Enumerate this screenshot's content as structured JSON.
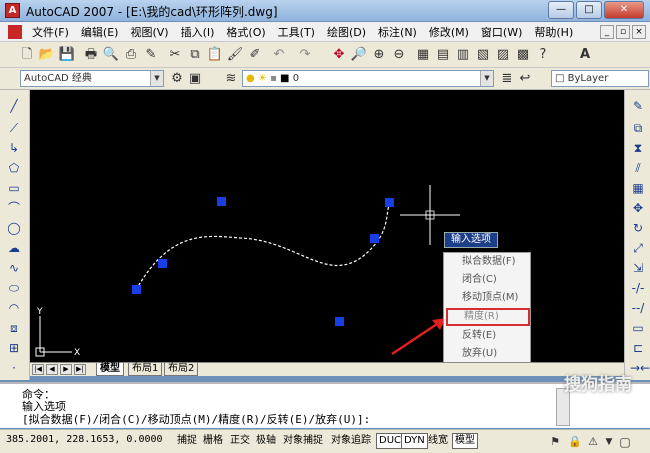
{
  "window": {
    "title": "AutoCAD 2007 - [E:\\我的cad\\环形阵列.dwg]"
  },
  "menu": [
    "文件(F)",
    "编辑(E)",
    "视图(V)",
    "插入(I)",
    "格式(O)",
    "工具(T)",
    "绘图(D)",
    "标注(N)",
    "修改(M)",
    "窗口(W)",
    "帮助(H)"
  ],
  "toolbar2": {
    "workspace": "AutoCAD 经典",
    "layer": "0",
    "linetype": "ByLayer"
  },
  "context_menu": {
    "title": "输入选项",
    "items": [
      "拟合数据(F)",
      "闭合(C)",
      "移动顶点(M)",
      "精度(R)",
      "反转(E)",
      "放弃(U)"
    ],
    "highlighted_index": 3
  },
  "ucs": {
    "x": "X",
    "y": "Y"
  },
  "layout_tabs": [
    "模型",
    "布局1",
    "布局2"
  ],
  "command": {
    "line1": "命令：",
    "line2": "输入选项",
    "line3": "[拟合数据(F)/闭合(C)/移动顶点(M)/精度(R)/反转(E)/放弃(U)]:"
  },
  "status": {
    "coords": "385.2001,  228.1653,  0.0000",
    "toggles": [
      "捕捉",
      "栅格",
      "正交",
      "极轴",
      "对象捕捉",
      "对象追踪",
      "DUCS",
      "DYN",
      "线宽",
      "模型"
    ]
  },
  "watermark": "搜狗指南",
  "colors": {
    "canvas": "#000000",
    "grip": "#1a3ee6",
    "highlight": "#d32f2f",
    "arrow": "#e02020"
  }
}
